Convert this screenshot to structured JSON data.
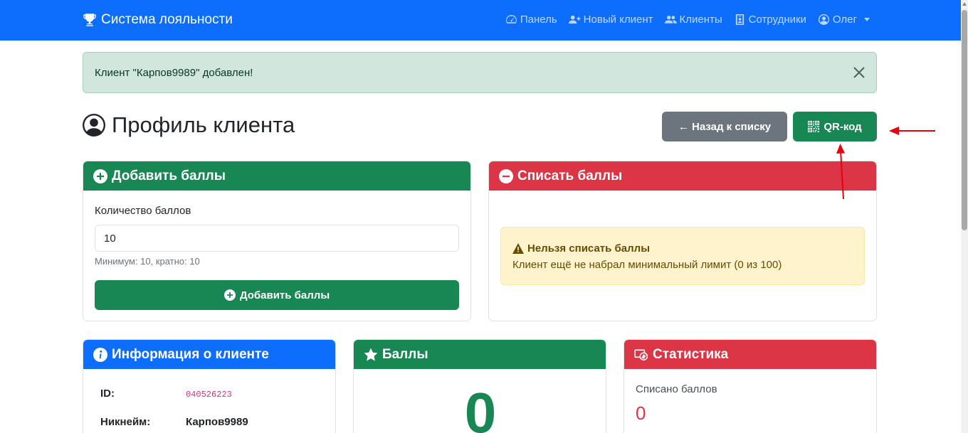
{
  "navbar": {
    "brand": "Система лояльности",
    "links": {
      "dashboard": "Панель",
      "new_client": "Новый клиент",
      "clients": "Клиенты",
      "employees": "Сотрудники",
      "user": "Олег"
    }
  },
  "alert": {
    "message": "Клиент \"Карпов9989\" добавлен!"
  },
  "page": {
    "title": "Профиль клиента",
    "back_button": "← Назад к списку",
    "qr_button": "QR-код"
  },
  "add_card": {
    "header": "Добавить баллы",
    "field_label": "Количество баллов",
    "field_value": "10",
    "hint": "Минимум: 10, кратно: 10",
    "submit": "Добавить баллы"
  },
  "sub_card": {
    "header": "Списать баллы",
    "warning_title": "Нельзя списать баллы",
    "warning_text": "Клиент ещё не набрал минимальный лимит (0 из 100)"
  },
  "info_card": {
    "header": "Информация о клиенте",
    "id_label": "ID:",
    "id_value": "040526223",
    "nick_label": "Никнейм:",
    "nick_value": "Карпов9989"
  },
  "points_card": {
    "header": "Баллы",
    "value": "0"
  },
  "stats_card": {
    "header": "Статистика",
    "spent_label": "Списано баллов",
    "spent_value": "0"
  },
  "colors": {
    "primary": "#0d6efd",
    "success": "#198754",
    "danger": "#dc3545",
    "secondary": "#6c757d",
    "annotation": "#e8000d"
  },
  "icons": [
    "trophy-icon",
    "dashboard-icon",
    "user-plus-icon",
    "users-icon",
    "badge-icon",
    "user-circle-icon",
    "close-icon",
    "qr-icon",
    "plus-circle-icon",
    "minus-circle-icon",
    "warning-icon",
    "info-icon",
    "star-icon",
    "cash-icon"
  ]
}
